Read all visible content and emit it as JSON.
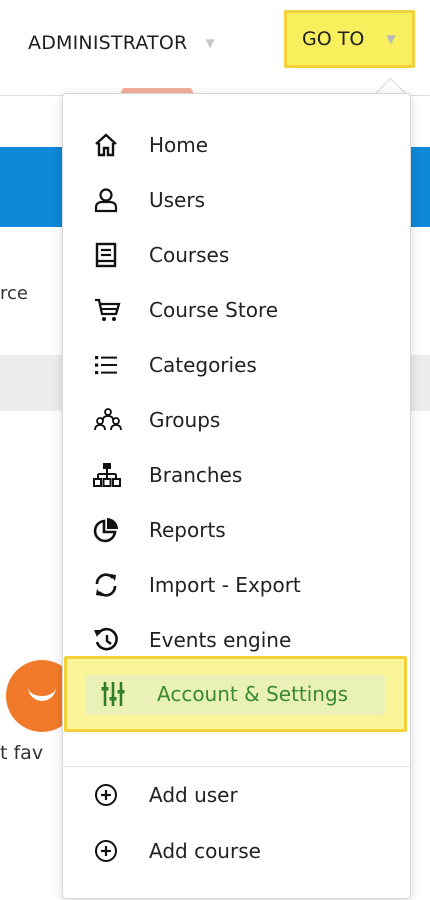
{
  "header": {
    "admin_label": "ADMINISTRATOR",
    "goto_label": "GO TO",
    "highlight_color": "#f8ef5c"
  },
  "background": {
    "fragment_text_1": "rce",
    "fragment_text_2": "t fav"
  },
  "menu": {
    "items": [
      {
        "label": "Home",
        "icon": "home-icon"
      },
      {
        "label": "Users",
        "icon": "user-icon"
      },
      {
        "label": "Courses",
        "icon": "book-icon"
      },
      {
        "label": "Course Store",
        "icon": "cart-icon"
      },
      {
        "label": "Categories",
        "icon": "list-icon"
      },
      {
        "label": "Groups",
        "icon": "group-icon"
      },
      {
        "label": "Branches",
        "icon": "sitemap-icon"
      },
      {
        "label": "Reports",
        "icon": "pie-chart-icon"
      },
      {
        "label": "Import - Export",
        "icon": "sync-icon"
      },
      {
        "label": "Events engine",
        "icon": "history-icon"
      },
      {
        "label": "Account & Settings",
        "icon": "sliders-icon",
        "active": true
      }
    ],
    "actions": [
      {
        "label": "Add user",
        "icon": "plus-circle-icon"
      },
      {
        "label": "Add course",
        "icon": "plus-circle-icon"
      }
    ],
    "active_color": "#3a8a2e"
  }
}
